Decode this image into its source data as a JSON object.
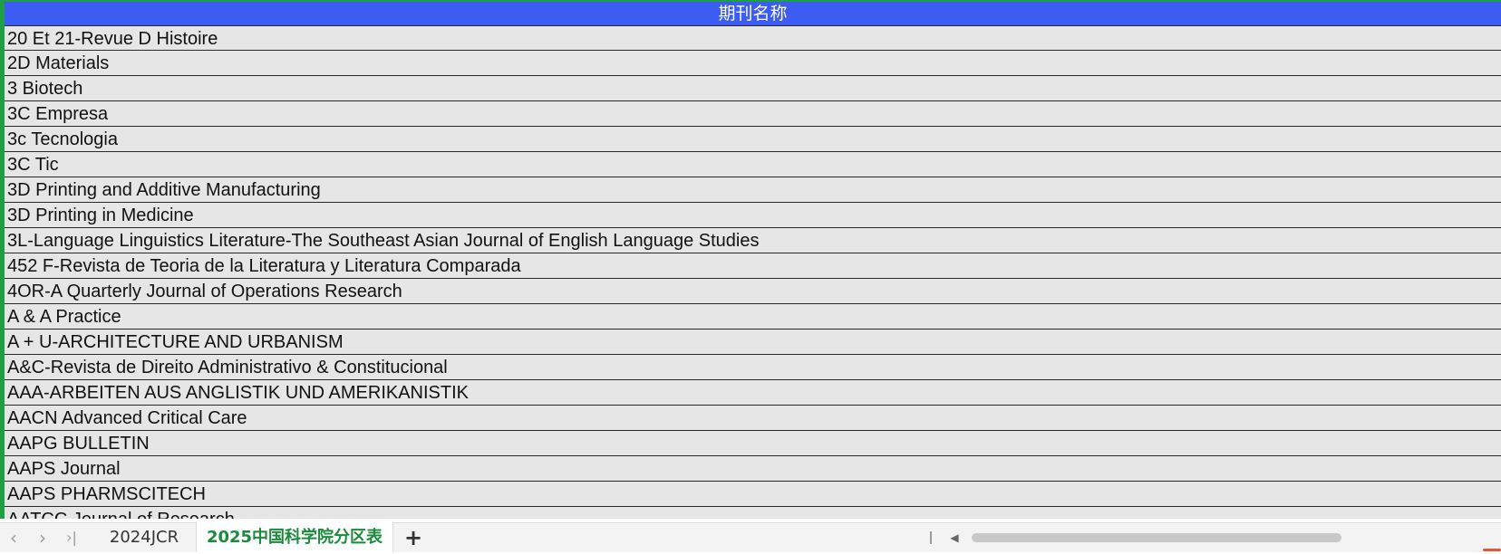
{
  "sheet": {
    "header": "期刊名称",
    "rows": [
      "20 Et 21-Revue D Histoire",
      "2D Materials",
      "3 Biotech",
      "3C Empresa",
      "3c Tecnologia",
      "3C Tic",
      "3D Printing and Additive Manufacturing",
      "3D Printing in Medicine",
      "3L-Language Linguistics Literature-The Southeast Asian Journal of English Language Studies",
      "452 F-Revista de Teoria de la Literatura y Literatura Comparada",
      "4OR-A Quarterly Journal of Operations Research",
      "A & A Practice",
      "A + U-ARCHITECTURE AND URBANISM",
      "A&C-Revista de Direito Administrativo & Constitucional",
      "AAA-ARBEITEN AUS ANGLISTIK UND AMERIKANISTIK",
      "AACN Advanced Critical Care",
      "AAPG BULLETIN",
      "AAPS Journal",
      "AAPS PHARMSCITECH",
      "AATCC Journal of Research"
    ]
  },
  "tabbar": {
    "nav_prev": "‹",
    "nav_next": "›",
    "nav_last": "›|",
    "tabs": [
      {
        "label": "2024JCR",
        "active": false
      },
      {
        "label": "2025中国科学院分区表",
        "active": true
      }
    ],
    "add_sheet": "+",
    "scroll_left": "◀"
  },
  "colors": {
    "header_bg": "#3d5cf3",
    "header_text": "#ffffff",
    "row_bg": "#e6e6e6",
    "accent_green": "#1e9f45",
    "active_tab_text": "#1a8a3c"
  }
}
